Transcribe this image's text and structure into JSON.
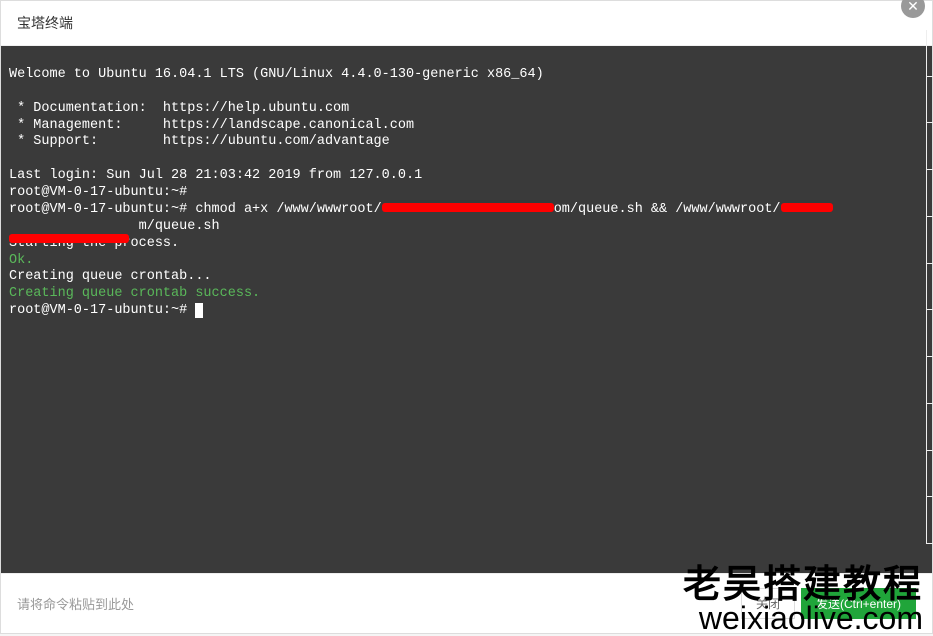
{
  "header": {
    "title": "宝塔终端"
  },
  "terminal": {
    "welcome": "Welcome to Ubuntu 16.04.1 LTS (GNU/Linux 4.4.0-130-generic x86_64)",
    "doc_label": " * Documentation:  https://help.ubuntu.com",
    "mgmt_label": " * Management:     https://landscape.canonical.com",
    "support_label": " * Support:        https://ubuntu.com/advantage",
    "last_login": "Last login: Sun Jul 28 21:03:42 2019 from 127.0.0.1",
    "prompt1": "root@VM-0-17-ubuntu:~# ",
    "prompt2_pre": "root@VM-0-17-ubuntu:~# ",
    "cmd_part1": "chmod a+x /www/wwwroot/",
    "cmd_part2": "om/queue.sh && /www/wwwroot/",
    "cmd_line2": "m/queue.sh",
    "starting": "Starting the process.",
    "ok": "Ok.",
    "creating": "Creating queue crontab...",
    "creating_success": "Creating queue crontab success.",
    "prompt3": "root@VM-0-17-ubuntu:~# "
  },
  "footer": {
    "placeholder": "请将命令粘贴到此处",
    "close_btn": "关闭",
    "send_btn": "发送(Ctrl+enter)"
  },
  "watermark": {
    "line1": "老吴搭建教程",
    "line2": "weixiaolive.com"
  }
}
